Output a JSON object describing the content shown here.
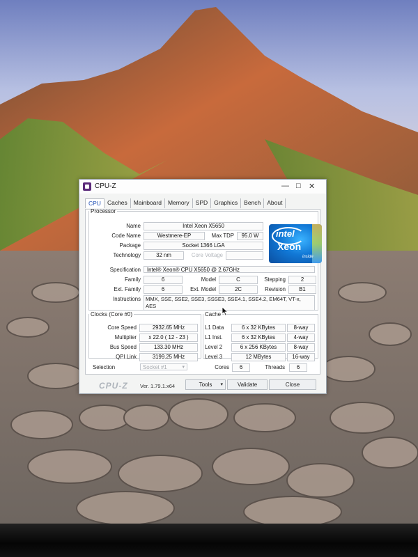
{
  "window": {
    "title": "CPU-Z",
    "controls": {
      "minimize": "—",
      "maximize": "□",
      "close": "✕"
    }
  },
  "tabs": [
    "CPU",
    "Caches",
    "Mainboard",
    "Memory",
    "SPD",
    "Graphics",
    "Bench",
    "About"
  ],
  "active_tab": "CPU",
  "processor": {
    "legend": "Processor",
    "name_label": "Name",
    "name": "Intel Xeon X5650",
    "code_name_label": "Code Name",
    "code_name": "Westmere-EP",
    "max_tdp_label": "Max TDP",
    "max_tdp": "95.0 W",
    "package_label": "Package",
    "package": "Socket 1366 LGA",
    "technology_label": "Technology",
    "technology": "32 nm",
    "core_voltage_label": "Core Voltage",
    "core_voltage": "",
    "specification_label": "Specification",
    "specification": "Intel® Xeon® CPU        X5650  @ 2.67GHz",
    "family_label": "Family",
    "family": "6",
    "model_label": "Model",
    "model": "C",
    "stepping_label": "Stepping",
    "stepping": "2",
    "ext_family_label": "Ext. Family",
    "ext_family": "6",
    "ext_model_label": "Ext. Model",
    "ext_model": "2C",
    "revision_label": "Revision",
    "revision": "B1",
    "instructions_label": "Instructions",
    "instructions_line1": "MMX, SSE, SSE2, SSE3, SSSE3, SSE4.1, SSE4.2, EM64T, VT-x,",
    "instructions_line2": "AES"
  },
  "logo": {
    "brand": "intel",
    "product": "Xeon",
    "tagline": "inside"
  },
  "clocks": {
    "legend": "Clocks (Core #0)",
    "core_speed_label": "Core Speed",
    "core_speed": "2932.65 MHz",
    "multiplier_label": "Multiplier",
    "multiplier": "x 22.0 ( 12 - 23 )",
    "bus_speed_label": "Bus Speed",
    "bus_speed": "133.30 MHz",
    "qpi_link_label": "QPI Link",
    "qpi_link": "3199.25 MHz"
  },
  "cache": {
    "legend": "Cache",
    "rows": [
      {
        "label": "L1 Data",
        "size": "6 x 32 KBytes",
        "ways": "8-way"
      },
      {
        "label": "L1 Inst.",
        "size": "6 x 32 KBytes",
        "ways": "4-way"
      },
      {
        "label": "Level 2",
        "size": "6 x 256 KBytes",
        "ways": "8-way"
      },
      {
        "label": "Level 3",
        "size": "12 MBytes",
        "ways": "16-way"
      }
    ]
  },
  "selection": {
    "label": "Selection",
    "value": "Socket #1",
    "cores_label": "Cores",
    "cores": "6",
    "threads_label": "Threads",
    "threads": "6"
  },
  "footer": {
    "brand": "CPU-Z",
    "version": "Ver. 1.79.1.x64",
    "tools": "Tools",
    "validate": "Validate",
    "close": "Close"
  },
  "colors": {
    "tab_active": "#1f4fb5",
    "window_bg": "#f3f4f3",
    "intel_blue": "#1178d6"
  }
}
